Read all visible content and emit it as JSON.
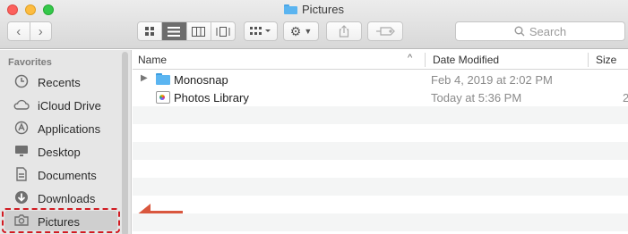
{
  "window": {
    "title": "Pictures",
    "traffic_lights": [
      "close",
      "minimize",
      "zoom"
    ]
  },
  "toolbar": {
    "back_icon": "chevron-left-icon",
    "forward_icon": "chevron-right-icon",
    "view_modes": [
      "icon-view",
      "list-view",
      "column-view",
      "gallery-view"
    ],
    "active_view": "list-view",
    "search_placeholder": "Search"
  },
  "sidebar": {
    "heading": "Favorites",
    "items": [
      {
        "label": "Recents",
        "icon": "clock-icon"
      },
      {
        "label": "iCloud Drive",
        "icon": "cloud-icon"
      },
      {
        "label": "Applications",
        "icon": "applications-icon"
      },
      {
        "label": "Desktop",
        "icon": "desktop-icon"
      },
      {
        "label": "Documents",
        "icon": "document-icon"
      },
      {
        "label": "Downloads",
        "icon": "download-icon"
      },
      {
        "label": "Pictures",
        "icon": "camera-icon",
        "selected": true
      }
    ]
  },
  "list": {
    "columns": {
      "name": "Name",
      "date": "Date Modified",
      "size": "Size"
    },
    "rows": [
      {
        "name": "Monosnap",
        "date": "Feb 4, 2019 at 2:02 PM",
        "size": "",
        "kind": "folder"
      },
      {
        "name": "Photos Library",
        "date": "Today at 5:36 PM",
        "size": "2",
        "kind": "photos-library"
      }
    ]
  },
  "colors": {
    "highlight_border": "#d11b22",
    "arrow": "#d9573e",
    "folder": "#5bb5f1"
  }
}
